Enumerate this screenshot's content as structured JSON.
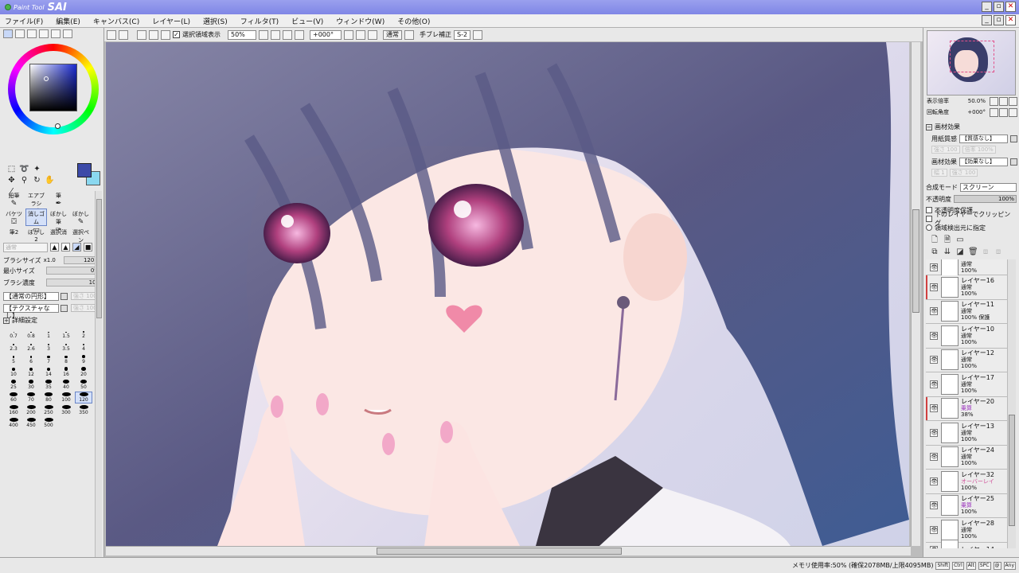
{
  "app": {
    "logo_text": "Paint Tool",
    "name": "SAI"
  },
  "menu": [
    "ファイル(F)",
    "編集(E)",
    "キャンバス(C)",
    "レイヤー(L)",
    "選択(S)",
    "フィルタ(T)",
    "ビュー(V)",
    "ウィンドウ(W)",
    "その他(O)"
  ],
  "colors": {
    "foreground": "#3c4aa8",
    "background": "#8ad8f0",
    "title_bar": "#8a90ea"
  },
  "toolbar": {
    "selection_display_label": "選択領域表示",
    "selection_display_checked": true,
    "zoom": "50%",
    "rotation": "+000°",
    "blend_btn": "通常",
    "stabilizer_label": "手ブレ補正",
    "stabilizer_value": "S-2"
  },
  "tools": {
    "icons": [
      "select-rect",
      "lasso",
      "magic-wand",
      "move",
      "zoom",
      "rotate",
      "hand",
      "eyedropper"
    ],
    "brushes": [
      {
        "name": "鉛筆",
        "icon": "pencil"
      },
      {
        "name": "エアブラシ",
        "icon": "airbrush"
      },
      {
        "name": "筆",
        "icon": "brush"
      },
      {
        "name": "",
        "icon": ""
      },
      {
        "name": "バケツ",
        "icon": "bucket"
      },
      {
        "name": "消しゴム",
        "icon": "eraser",
        "active": true
      },
      {
        "name": "ぼかし筆",
        "icon": "blur-brush"
      },
      {
        "name": "ぼかし",
        "icon": "blur"
      },
      {
        "name": "筆2",
        "icon": "brush2"
      },
      {
        "name": "ぼかし2",
        "icon": "blur2"
      },
      {
        "name": "選択消",
        "icon": "select-erase"
      },
      {
        "name": "選択ペン",
        "icon": "select-pen"
      }
    ],
    "shape_mode_label": "通常",
    "brush_size_label": "ブラシサイズ",
    "brush_size_mult": "x1.0",
    "brush_size_value": "120.0",
    "min_size_label": "最小サイズ",
    "min_size_value": "0%",
    "density_label": "ブラシ濃度",
    "density_value": "100",
    "shape_dd": "【通常の円形】",
    "shape_ghost": "強さ 100",
    "texture_dd": "【テクスチャなし】",
    "texture_ghost": "強さ 100",
    "detail_label": "詳細設定"
  },
  "brush_sizes": [
    "0.7",
    "0.8",
    "1",
    "1.5",
    "2",
    "2.3",
    "2.6",
    "3",
    "3.5",
    "4",
    "5",
    "6",
    "7",
    "8",
    "9",
    "10",
    "12",
    "14",
    "16",
    "20",
    "25",
    "30",
    "35",
    "40",
    "50",
    "60",
    "70",
    "80",
    "100",
    "120",
    "160",
    "200",
    "250",
    "300",
    "350",
    "400",
    "450",
    "500"
  ],
  "brush_size_active": "120",
  "navigator": {
    "zoom_label": "表示倍率",
    "zoom_value": "50.0%",
    "angle_label": "回転角度",
    "angle_value": "+000°"
  },
  "paper": {
    "title": "画材効果",
    "texture_label": "用紙質感",
    "texture_value": "【質感なし】",
    "texture_ghost_a": "強さ 100",
    "texture_ghost_b": "倍率 100%",
    "effect_label": "画材効果",
    "effect_value": "【効果なし】",
    "effect_ghost_a": "幅 1",
    "effect_ghost_b": "強さ 100"
  },
  "layer_props": {
    "blend_label": "合成モード",
    "blend_value": "スクリーン",
    "opacity_label": "不透明度",
    "opacity_value": "100%",
    "protect_opacity": "不透明度保護",
    "clip_below": "下のレイヤーでクリッピング",
    "selection_source": "領域検出元に指定"
  },
  "layers": [
    {
      "name": "",
      "blend": "通常",
      "opacity": "100%",
      "partial": true
    },
    {
      "name": "レイヤー16",
      "blend": "通常",
      "opacity": "100%",
      "red": true
    },
    {
      "name": "レイヤー11",
      "blend": "通常",
      "opacity": "100% 保護"
    },
    {
      "name": "レイヤー10",
      "blend": "通常",
      "opacity": "100%"
    },
    {
      "name": "レイヤー12",
      "blend": "通常",
      "opacity": "100%"
    },
    {
      "name": "レイヤー17",
      "blend": "通常",
      "opacity": "100%"
    },
    {
      "name": "レイヤー20",
      "blend": "乗算",
      "opacity": "38%",
      "blend_color": "purple",
      "red": true
    },
    {
      "name": "レイヤー13",
      "blend": "通常",
      "opacity": "100%"
    },
    {
      "name": "レイヤー24",
      "blend": "通常",
      "opacity": "100%"
    },
    {
      "name": "レイヤー32",
      "blend": "オーバーレイ",
      "opacity": "100%",
      "blend_color": "pink"
    },
    {
      "name": "レイヤー25",
      "blend": "乗算",
      "opacity": "100%",
      "blend_color": "purple"
    },
    {
      "name": "レイヤー28",
      "blend": "通常",
      "opacity": "100%"
    },
    {
      "name": "レイヤー14",
      "blend": "",
      "opacity": "",
      "partial": true
    }
  ],
  "status": {
    "memory": "メモリ使用率:50% (確保2078MB/上限4095MB)",
    "keys": [
      "Shift",
      "Ctrl",
      "Alt",
      "SPC",
      "@",
      "Any"
    ]
  }
}
